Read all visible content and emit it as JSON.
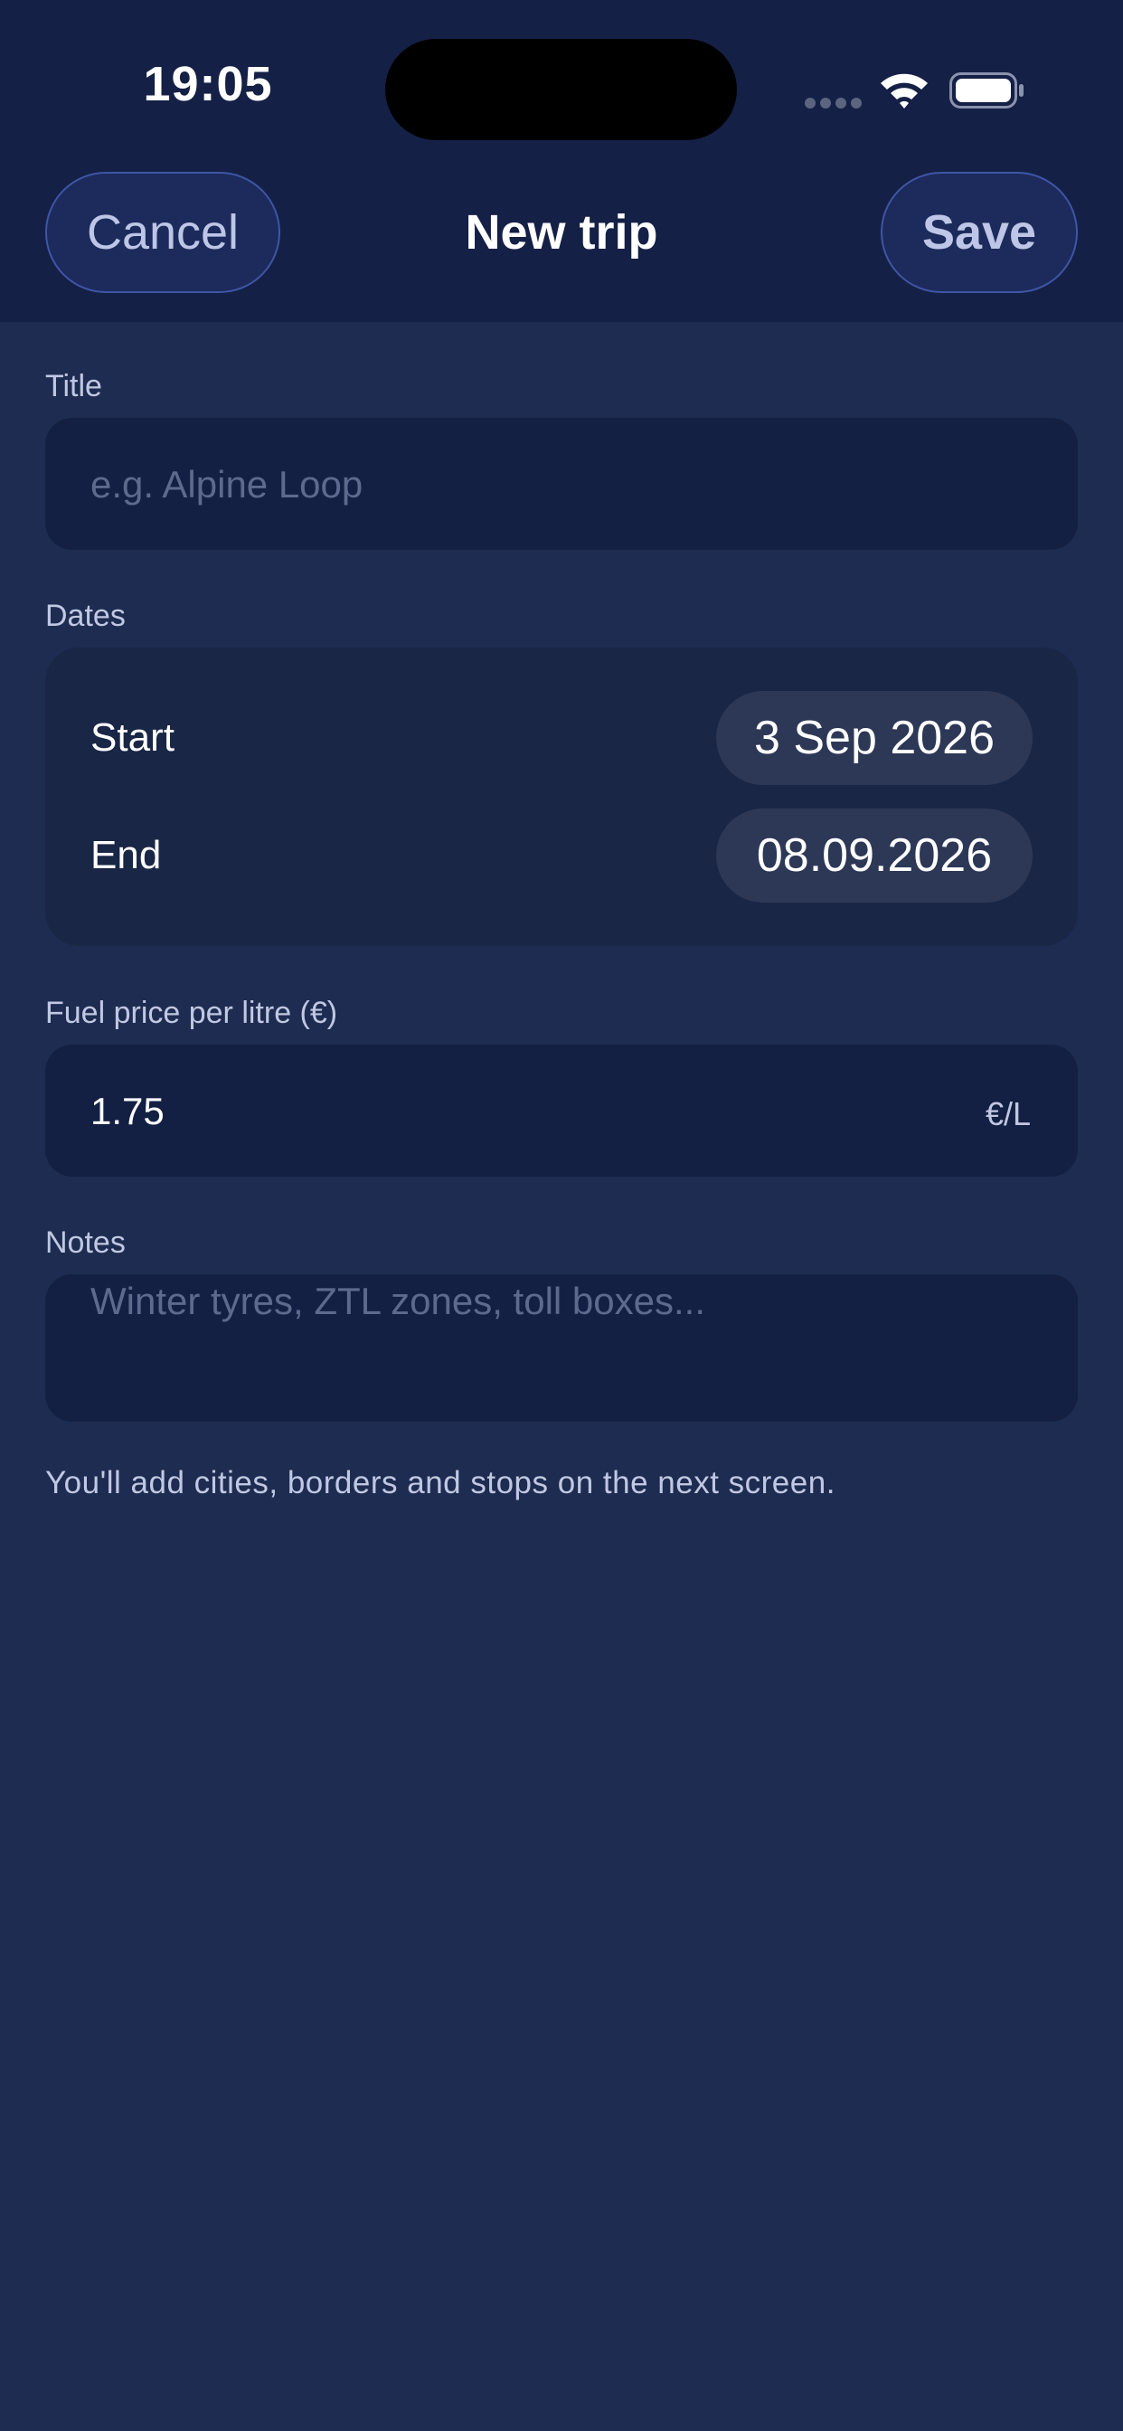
{
  "status_bar": {
    "time": "19:05"
  },
  "nav": {
    "cancel_label": "Cancel",
    "title": "New trip",
    "save_label": "Save"
  },
  "form": {
    "title": {
      "label": "Title",
      "placeholder": "e.g. Alpine Loop",
      "value": ""
    },
    "dates": {
      "label": "Dates",
      "start_label": "Start",
      "start_value": "3 Sep 2026",
      "end_label": "End",
      "end_value": "08.09.2026"
    },
    "fuel": {
      "label": "Fuel price per litre (€)",
      "value": "1.75",
      "unit": "€/L"
    },
    "notes": {
      "label": "Notes",
      "placeholder": "Winter tyres, ZTL zones, toll boxes...",
      "value": ""
    },
    "footnote": "You'll add cities, borders and stops on the next screen."
  },
  "colors": {
    "background": "#1E2C51",
    "header": "#142045",
    "field": "#132043",
    "card": "#192646",
    "pill": "#2D3857",
    "button_fill": "#1C2B5C",
    "button_border": "#3F55A6",
    "secondary_text": "#C0C8E2",
    "placeholder_text": "#5E6A8C"
  },
  "icons": {
    "signal": "cellular-signal-icon",
    "wifi": "wifi-icon",
    "battery": "battery-icon"
  }
}
